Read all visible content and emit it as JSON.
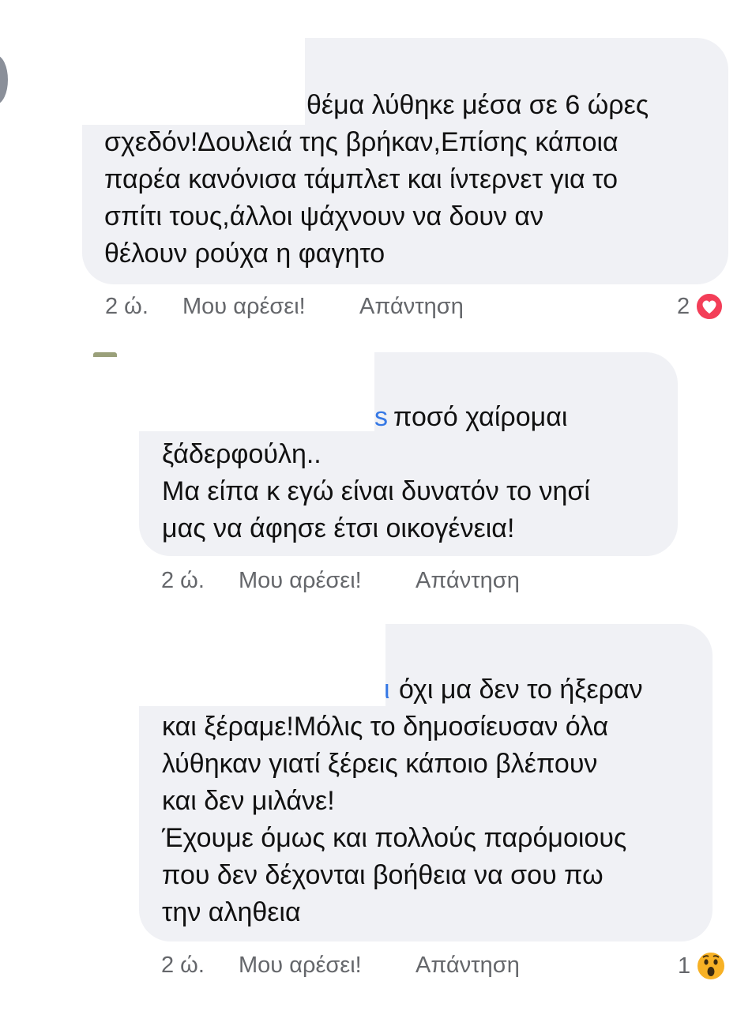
{
  "comments": [
    {
      "lines": [
        "θέμα λύθηκε μέσα σε 6 ώρες",
        "σχεδόν!Δουλειά της βρήκαν,Επίσης κάποια",
        "παρέα κανόνισα τάμπλετ και ίντερνετ για το",
        "σπίτι τους,άλλοι ψάχνουν να δουν αν",
        "θέλουν ρούχα η φαγητο"
      ],
      "time": "2 ώ.",
      "like": "Μου αρέσει!",
      "reply": "Απάντηση",
      "reaction_count": "2",
      "reaction": "love"
    },
    {
      "name_fragment": "s",
      "lines": [
        "ποσό χαίρομαι",
        "ξάδερφούλη..",
        "Μα είπα κ εγώ είναι δυνατόν το νησί",
        "μας να άφησε έτσι οικογένεια!"
      ],
      "time": "2 ώ.",
      "like": "Μου αρέσει!",
      "reply": "Απάντηση"
    },
    {
      "name_fragment": "ι",
      "lines": [
        "όχι μα δεν το ήξεραν",
        "και ξέραμε!Μόλις το δημοσίευσαν όλα",
        "λύθηκαν γιατί ξέρεις κάποιο βλέπουν",
        "και δεν μιλάνε!",
        "Έχουμε όμως και πολλούς παρόμοιους",
        "που δεν δέχονται βοήθεια να σου πω",
        "την αληθεια"
      ],
      "time": "2 ώ.",
      "like": "Μου αρέσει!",
      "reply": "Απάντηση",
      "reaction_count": "1",
      "reaction": "wow"
    }
  ],
  "colors": {
    "bubble": "#f0f1f5",
    "meta": "#65676b",
    "link": "#3578e5",
    "love": "#f33e58",
    "wow": "#f7b125"
  }
}
